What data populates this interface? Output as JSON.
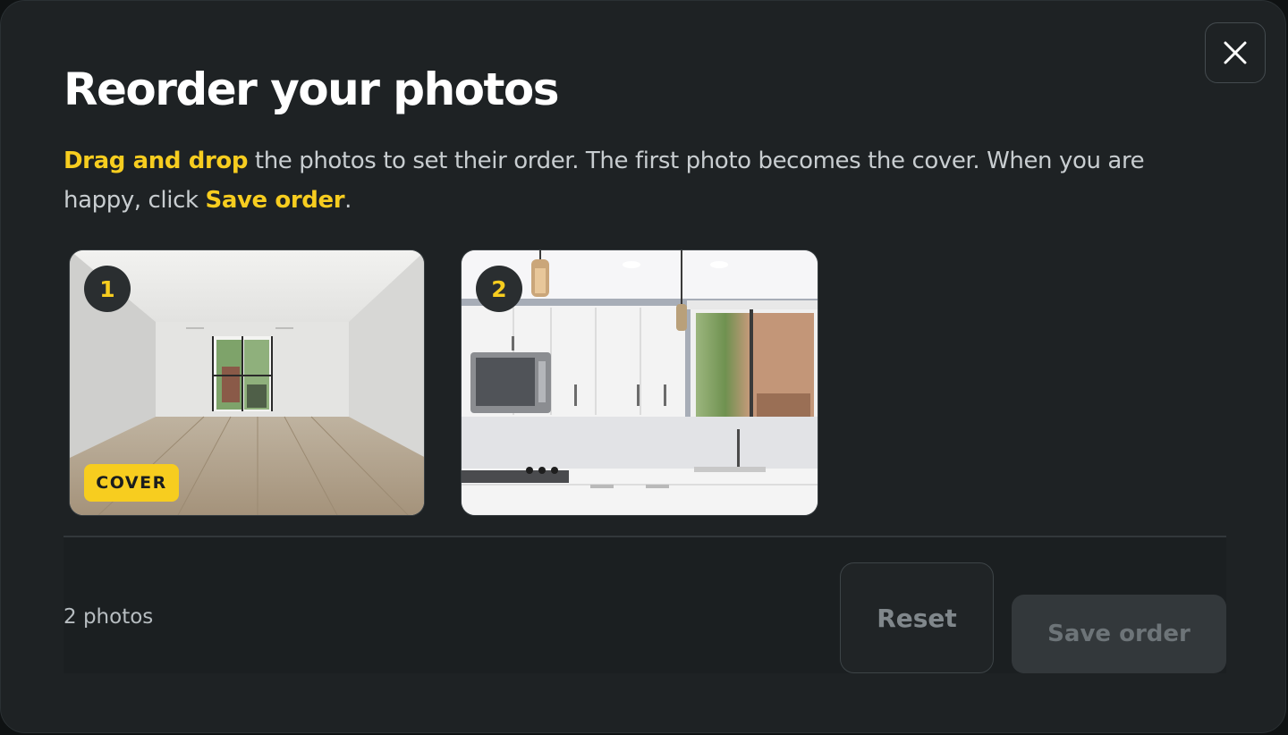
{
  "dialog": {
    "title": "Reorder your photos",
    "description": {
      "highlight_1": "Drag and drop",
      "text_1": " the photos to set their order. The first photo becomes the cover. When you are happy, click ",
      "highlight_2": "Save order",
      "text_2": "."
    },
    "close_icon": "close-icon"
  },
  "photos": [
    {
      "number": "1",
      "badge": "COVER",
      "subject": "empty-living-room"
    },
    {
      "number": "2",
      "badge": "",
      "subject": "white-kitchen"
    }
  ],
  "footer": {
    "count": "2 photos",
    "reset_label": "Reset",
    "save_label": "Save order"
  },
  "colors": {
    "accent": "#f7cd1f",
    "background": "#1e2224",
    "text": "#ffffff",
    "muted": "#b7bdc1"
  }
}
